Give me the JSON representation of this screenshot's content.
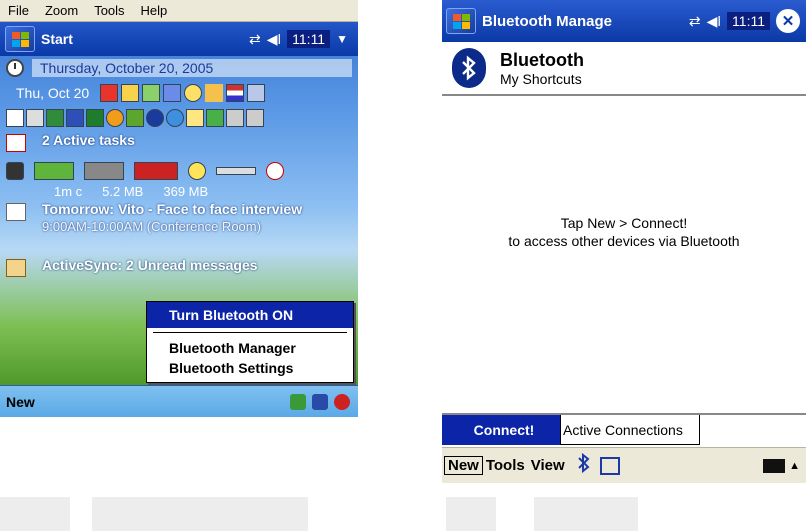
{
  "left": {
    "menubar": [
      "File",
      "Zoom",
      "Tools",
      "Help"
    ],
    "title": "Start",
    "clock": "11:11",
    "date_long": "Thursday, October 20, 2005",
    "date_short": "Thu, Oct 20",
    "tasks": "2 Active tasks",
    "status_values": [
      "1m c",
      "5.2 MB",
      "369 MB"
    ],
    "appointment": {
      "title": "Tomorrow: Vito - Face to face interview",
      "detail": "9:00AM-10:00AM (Conference Room)"
    },
    "activesync": "ActiveSync: 2 Unread messages",
    "popup": {
      "highlight": "Turn Bluetooth ON",
      "items": [
        "Bluetooth Manager",
        "Bluetooth Settings"
      ]
    },
    "softkey": "New"
  },
  "right": {
    "title": "Bluetooth Manage",
    "clock": "11:11",
    "close": "✕",
    "header": {
      "title": "Bluetooth",
      "subtitle": "My Shortcuts"
    },
    "message": [
      "Tap New > Connect!",
      "to access other devices via Bluetooth"
    ],
    "tabs": {
      "active": "Connect!",
      "other": "Active Connections"
    },
    "menubar": [
      "New",
      "Tools",
      "View"
    ]
  },
  "colors": {
    "highlight": "#0b24a8",
    "title_bar": "#0b3aa6",
    "menubar": "#ece9d8"
  }
}
